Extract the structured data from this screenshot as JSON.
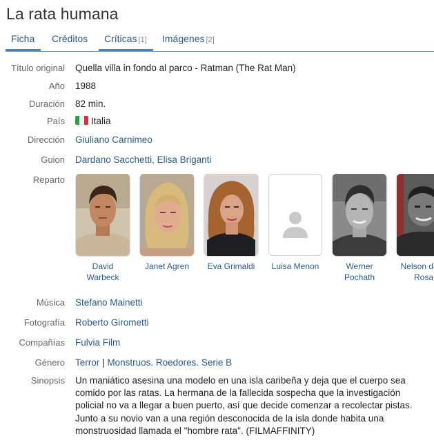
{
  "page_title": "La rata humana",
  "tabs": [
    {
      "label": "Ficha",
      "count": ""
    },
    {
      "label": "Créditos",
      "count": ""
    },
    {
      "label": "Críticas",
      "count": "[1]"
    },
    {
      "label": "Imágenes",
      "count": "[2]"
    }
  ],
  "fields": {
    "original_title": {
      "label": "Título original",
      "value": "Quella villa in fondo al parco - Ratman (The Rat Man)"
    },
    "year": {
      "label": "Año",
      "value": "1988"
    },
    "duration": {
      "label": "Duración",
      "value": "82 min."
    },
    "country": {
      "label": "País",
      "value": "Italia",
      "flag_colors": [
        "#2e9e4b",
        "#f2f2f2",
        "#d1323e"
      ]
    },
    "director": {
      "label": "Dirección",
      "value": "Giuliano Carnimeo"
    },
    "screenplay": {
      "label": "Guion",
      "value": "Dardano Sacchetti, Elisa Briganti"
    },
    "cast_label": "Reparto",
    "music": {
      "label": "Música",
      "value": "Stefano Mainetti"
    },
    "photography": {
      "label": "Fotografía",
      "value": "Roberto Girometti"
    },
    "companies": {
      "label": "Compañías",
      "value": "Fulvia Film"
    },
    "genre": {
      "label": "Género",
      "main": "Terror",
      "separator": "|",
      "topics": "Monstruos. Roedores. Serie B"
    },
    "synopsis": {
      "label": "Sinopsis",
      "value": "Un maniático asesina una modelo en una isla caribeña y deja que el cuerpo sea comido por las ratas. La hermana de la fallecida sospecha que la investigación policial no va a llegar a buen puerto, así que decide comenzar a recolectar pistas. Junto a su novio van a una región desconocida de la isla donde habita una monstruosidad llamada el \"hombre rata\". (FILMAFFINITY)"
    }
  },
  "cast": [
    {
      "name": "David Warbeck"
    },
    {
      "name": "Janet Agren"
    },
    {
      "name": "Eva Grimaldi"
    },
    {
      "name": "Luisa Menon"
    },
    {
      "name": "Werner Pochath"
    },
    {
      "name": "Nelson de la Rosa"
    }
  ],
  "colors": {
    "link": "#2b5b84",
    "tab_underline": "#4f86b8",
    "label": "#666666"
  }
}
